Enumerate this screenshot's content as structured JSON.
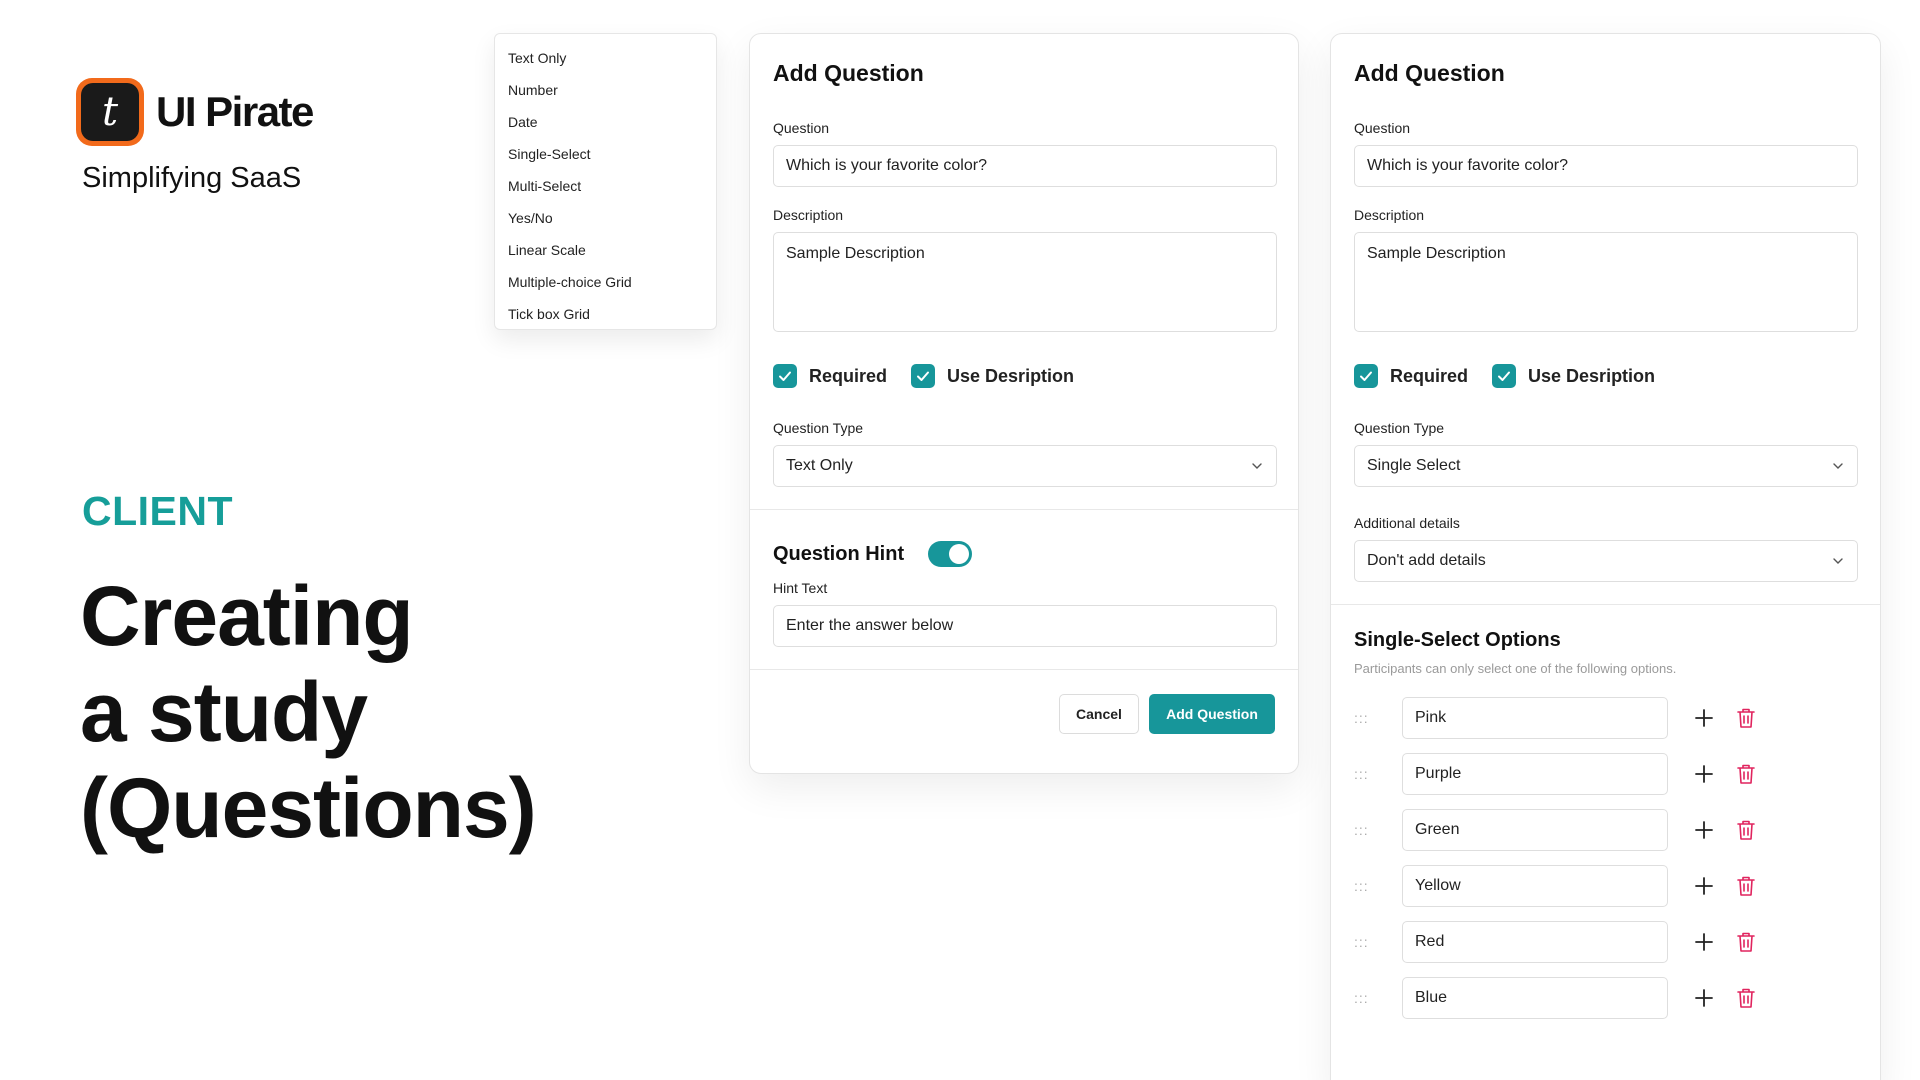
{
  "brand": {
    "name": "UI Pirate",
    "logo_letter": "t",
    "tagline": "Simplifying SaaS",
    "logo_color": "#f26a1b"
  },
  "hero": {
    "eyebrow": "CLIENT",
    "headline_lines": [
      "Creating",
      "a study",
      "(Questions)"
    ],
    "accent_color": "#169e99"
  },
  "type_dropdown": {
    "items": [
      "Text Only",
      "Number",
      "Date",
      "Single-Select",
      "Multi-Select",
      "Yes/No",
      "Linear Scale",
      "Multiple-choice Grid",
      "Tick box Grid"
    ]
  },
  "left_card": {
    "title": "Add Question",
    "question_label": "Question",
    "question_value": "Which is your favorite color?",
    "description_label": "Description",
    "description_value": "Sample Description",
    "required_label": "Required",
    "use_description_label": "Use Desription",
    "question_type_label": "Question Type",
    "question_type_value": "Text Only",
    "hint_title": "Question Hint",
    "hint_text_label": "Hint Text",
    "hint_text_value": "Enter the answer below",
    "cancel_label": "Cancel",
    "submit_label": "Add Question"
  },
  "right_card": {
    "title": "Add Question",
    "question_label": "Question",
    "question_value": "Which is your favorite color?",
    "description_label": "Description",
    "description_value": "Sample Description",
    "required_label": "Required",
    "use_description_label": "Use Desription",
    "question_type_label": "Question Type",
    "question_type_value": "Single Select",
    "additional_label": "Additional details",
    "additional_value": "Don't add details",
    "options_title": "Single-Select Options",
    "options_subtitle": "Participants can only select one of the following options.",
    "options": [
      "Pink",
      "Purple",
      "Green",
      "Yellow",
      "Red",
      "Blue"
    ]
  },
  "colors": {
    "primary": "#17969a",
    "danger": "#e0245e"
  }
}
